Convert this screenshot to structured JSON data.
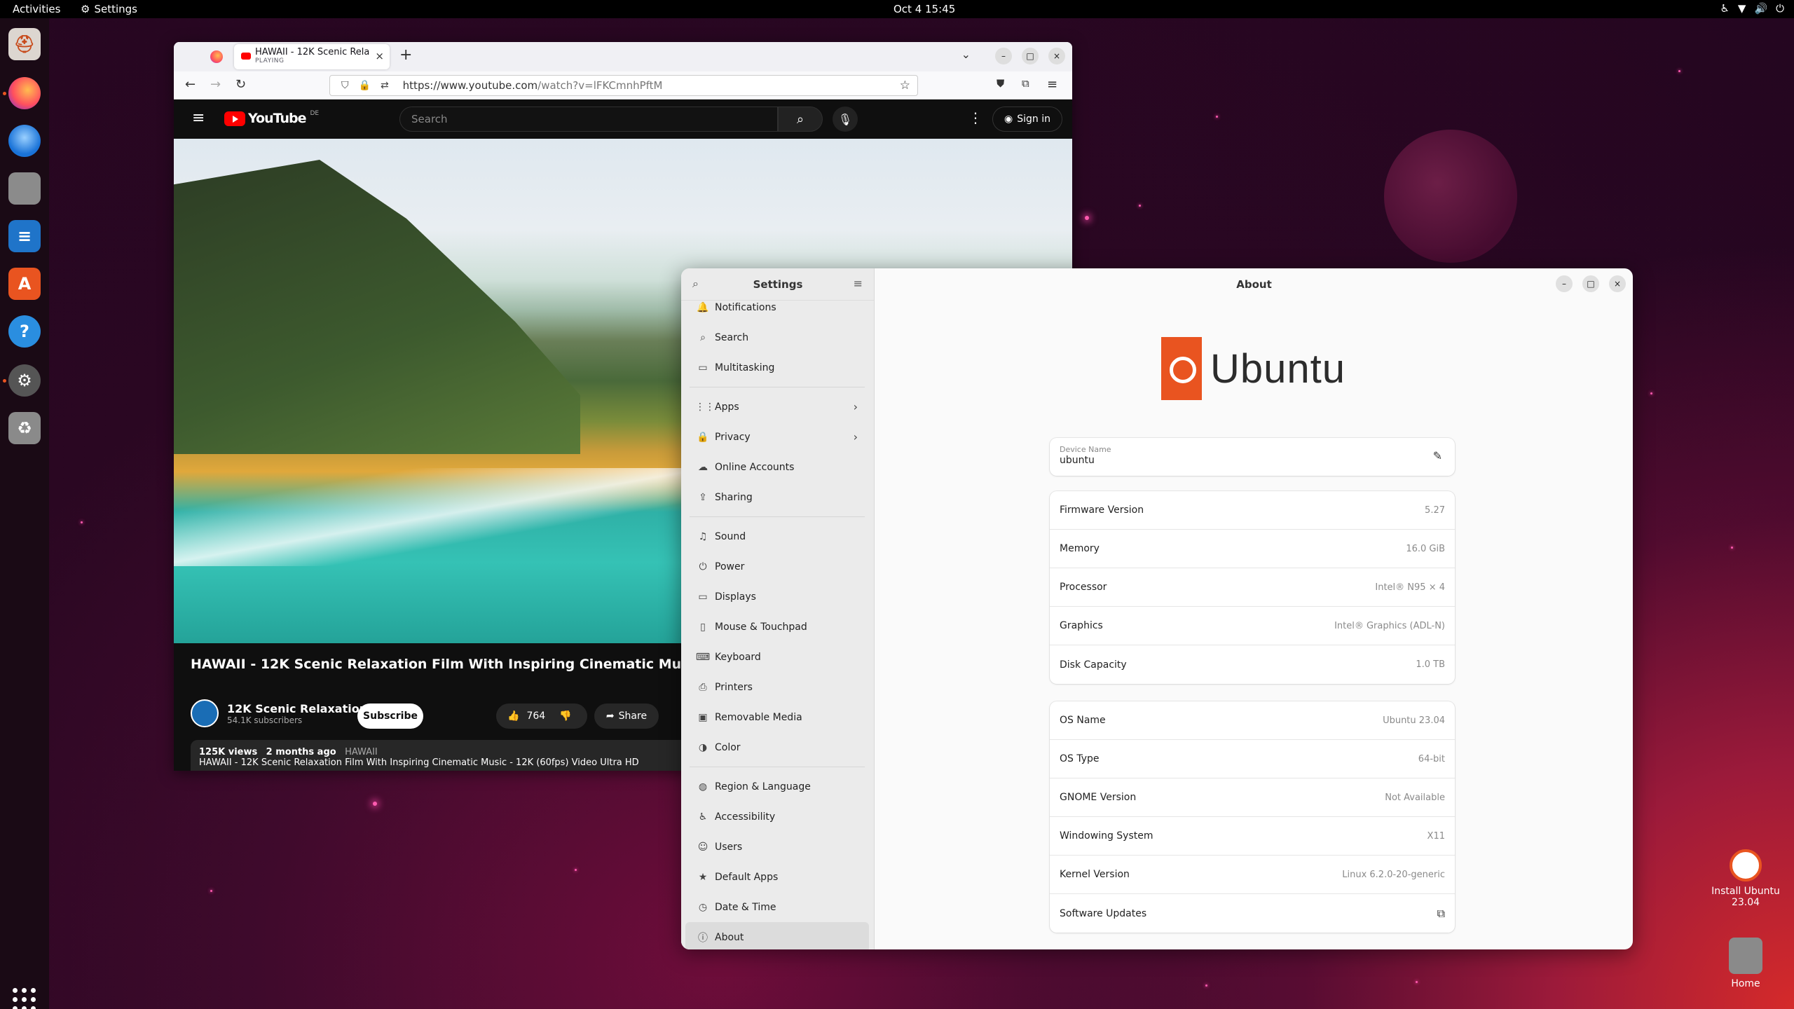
{
  "topbar": {
    "activities": "Activities",
    "app_menu": "Settings",
    "clock": "Oct 4  15:45"
  },
  "dock": {
    "items": [
      "help-icon",
      "firefox-icon",
      "thunderbird-icon",
      "files-icon",
      "writer-icon",
      "app-center-icon",
      "help-question-icon",
      "settings-gear-icon",
      "trash-icon"
    ]
  },
  "firefox": {
    "tab_title": "HAWAII - 12K Scenic Rela",
    "tab_status": "PLAYING",
    "url_host": "https://www.youtube.com",
    "url_path": "/watch?v=lFKCmnhPftM"
  },
  "youtube": {
    "logo": "YouTube",
    "region": "DE",
    "search_placeholder": "Search",
    "sign_in": "Sign in",
    "video_title": "HAWAII - 12K Scenic Relaxation Film With Inspiring Cinematic Music - 12K (60fps) Video Ultra HD",
    "channel_name": "12K Scenic Relaxation",
    "subscribers": "54.1K subscribers",
    "subscribe": "Subscribe",
    "likes": "764",
    "share": "Share",
    "views": "125K views",
    "ago": "2 months ago",
    "hashtag": "HAWAII",
    "description": "HAWAII - 12K Scenic Relaxation Film With Inspiring Cinematic Music - 12K (60fps) Video Ultra HD"
  },
  "settings": {
    "sidebar_title": "Settings",
    "main_title": "About",
    "sidebar": [
      {
        "label": "Notifications",
        "icon": "bell-icon"
      },
      {
        "label": "Search",
        "icon": "search-icon"
      },
      {
        "label": "Multitasking",
        "icon": "multitasking-icon"
      },
      {
        "label": "Apps",
        "icon": "apps-icon"
      },
      {
        "label": "Privacy",
        "icon": "lock-icon"
      },
      {
        "label": "Online Accounts",
        "icon": "cloud-icon"
      },
      {
        "label": "Sharing",
        "icon": "share-icon"
      },
      {
        "label": "Sound",
        "icon": "music-note-icon"
      },
      {
        "label": "Power",
        "icon": "power-icon"
      },
      {
        "label": "Displays",
        "icon": "display-icon"
      },
      {
        "label": "Mouse & Touchpad",
        "icon": "mouse-icon"
      },
      {
        "label": "Keyboard",
        "icon": "keyboard-icon"
      },
      {
        "label": "Printers",
        "icon": "printer-icon"
      },
      {
        "label": "Removable Media",
        "icon": "removable-media-icon"
      },
      {
        "label": "Color",
        "icon": "color-icon"
      },
      {
        "label": "Region & Language",
        "icon": "globe-icon"
      },
      {
        "label": "Accessibility",
        "icon": "accessibility-icon"
      },
      {
        "label": "Users",
        "icon": "users-icon"
      },
      {
        "label": "Default Apps",
        "icon": "star-icon"
      },
      {
        "label": "Date & Time",
        "icon": "clock-icon"
      },
      {
        "label": "About",
        "icon": "info-icon"
      }
    ],
    "logo_word": "Ubuntu",
    "device_name_label": "Device Name",
    "device_name": "ubuntu",
    "hardware": [
      {
        "label": "Firmware Version",
        "value": "5.27"
      },
      {
        "label": "Memory",
        "value": "16.0 GiB"
      },
      {
        "label": "Processor",
        "value": "Intel® N95 × 4"
      },
      {
        "label": "Graphics",
        "value": "Intel® Graphics (ADL-N)"
      },
      {
        "label": "Disk Capacity",
        "value": "1.0 TB"
      }
    ],
    "software": [
      {
        "label": "OS Name",
        "value": "Ubuntu 23.04"
      },
      {
        "label": "OS Type",
        "value": "64-bit"
      },
      {
        "label": "GNOME Version",
        "value": "Not Available"
      },
      {
        "label": "Windowing System",
        "value": "X11"
      },
      {
        "label": "Kernel Version",
        "value": "Linux 6.2.0-20-generic"
      },
      {
        "label": "Software Updates",
        "value": ""
      }
    ]
  },
  "desktop": {
    "install_label": "Install Ubuntu 23.04",
    "home_label": "Home"
  }
}
